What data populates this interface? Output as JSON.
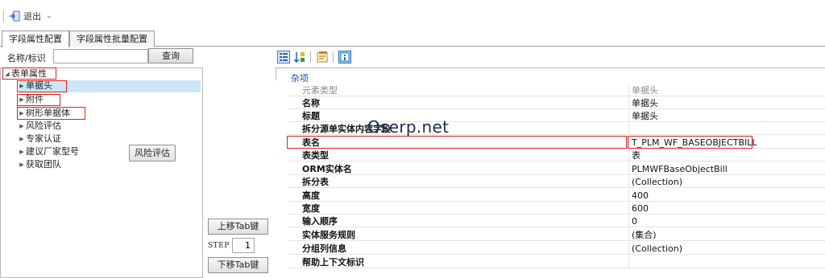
{
  "toolbar": {
    "exit_label": "退出"
  },
  "tabs": [
    {
      "label": "字段属性配置",
      "active": true
    },
    {
      "label": "字段属性批量配置",
      "active": false
    }
  ],
  "search": {
    "label": "名称/标识",
    "value": "",
    "query_button": "查询"
  },
  "tree": {
    "root": "表单属性",
    "items": [
      "单据头",
      "附件",
      "树形单据体",
      "风险评估",
      "专家认证",
      "建议厂家型号",
      "获取团队"
    ],
    "selected": "单据头"
  },
  "risk_button": "风险评估",
  "middle": {
    "move_up_label": "上移Tab键",
    "move_down_label": "下移Tab键",
    "step_label": "STEP",
    "step_value": "1"
  },
  "right_toolbar": {
    "icons": [
      "sort-category-icon",
      "sort-alpha-icon",
      "property-pages-icon",
      "info-icon"
    ]
  },
  "properties": {
    "category": "杂项",
    "rows": [
      {
        "name": "元素类型",
        "value": "单据头",
        "muted": true
      },
      {
        "name": "名称",
        "value": "单据头"
      },
      {
        "name": "标题",
        "value": "单据头"
      },
      {
        "name": "拆分源单实体内容字段",
        "value": ""
      },
      {
        "name": "表名",
        "value": "T_PLM_WF_BASEOBJECTBILL",
        "highlighted": true
      },
      {
        "name": "表类型",
        "value": "表"
      },
      {
        "name": "ORM实体名",
        "value": "PLMWFBaseObjectBill"
      },
      {
        "name": "拆分表",
        "value": "(Collection)"
      },
      {
        "name": "高度",
        "value": "400"
      },
      {
        "name": "宽度",
        "value": "600"
      },
      {
        "name": "输入顺序",
        "value": "0"
      },
      {
        "name": "实体服务规则",
        "value": "(集合)"
      },
      {
        "name": "分组列信息",
        "value": "(Collection)"
      },
      {
        "name": "帮助上下文标识",
        "value": ""
      }
    ]
  },
  "watermark": "Oserp.net",
  "colors": {
    "highlight_border": "#e0201a",
    "selection": "#cde6f7",
    "category_text": "#1f4fa5"
  }
}
